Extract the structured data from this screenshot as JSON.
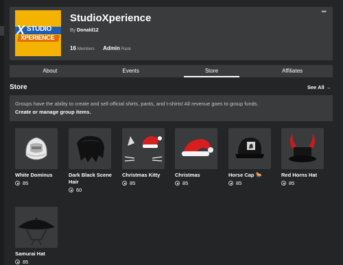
{
  "group": {
    "name": "StudioXperience",
    "by_label": "By",
    "owner": "Donald12",
    "members_count": "16",
    "members_label": "Members",
    "rank": "Admin",
    "rank_label": "Rank",
    "menu_icon": "more-dots-icon",
    "logo": {
      "line1": "STUDIO",
      "line2": "XPERIENCE",
      "x": "X"
    }
  },
  "tabs": [
    {
      "label": "About",
      "active": false
    },
    {
      "label": "Events",
      "active": false
    },
    {
      "label": "Store",
      "active": true
    },
    {
      "label": "Affiliates",
      "active": false
    }
  ],
  "store": {
    "heading": "Store",
    "see_all": "See All →",
    "info_text": "Groups have the ability to create and sell official shirts, pants, and t-shirts! All revenue goes to group funds.",
    "manage_link": "Create or manage group items.",
    "items": [
      {
        "name": "White Dominus",
        "price": "85"
      },
      {
        "name": "Dark Black Scene Hair",
        "price": "60"
      },
      {
        "name": "Christmas Kitty",
        "price": "85"
      },
      {
        "name": "Christmas",
        "price": "85"
      },
      {
        "name": "Horse Cap",
        "badge": "🐎",
        "price": "85"
      },
      {
        "name": "Red Horns Hat",
        "price": "85"
      },
      {
        "name": "Samurai Hat",
        "price": "85"
      }
    ]
  },
  "colors": {
    "page_bg": "#232527",
    "card_bg": "#393b3d",
    "logo_yellow": "#f5b301",
    "logo_blue": "#1f5fb0",
    "logo_orange": "#e07000"
  }
}
